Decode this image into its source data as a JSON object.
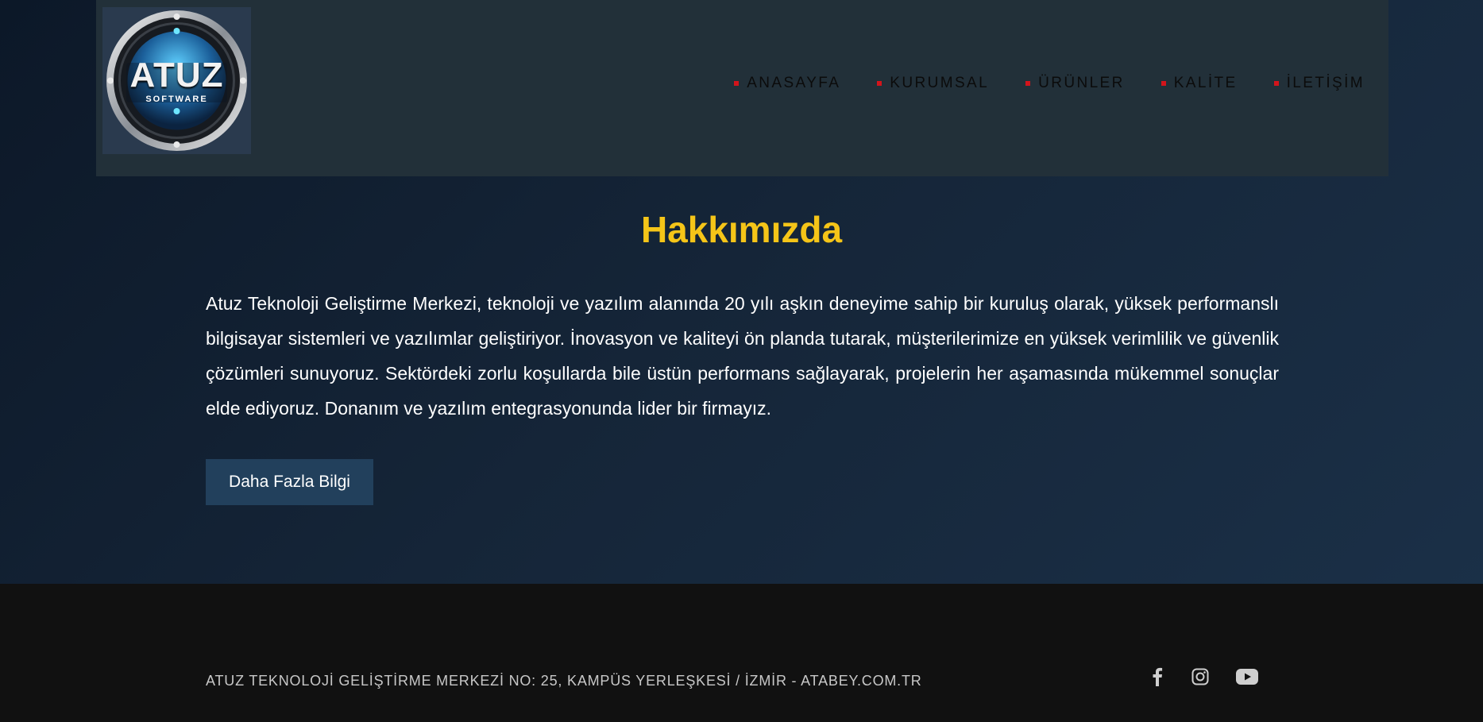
{
  "header": {
    "logo": {
      "text": "ATUZ",
      "subtext": "SOFTWARE"
    },
    "nav": [
      {
        "label": "ANASAYFA"
      },
      {
        "label": "KURUMSAL"
      },
      {
        "label": "ÜRÜNLER"
      },
      {
        "label": "KALİTE"
      },
      {
        "label": "İLETİŞİM"
      }
    ]
  },
  "main": {
    "title": "Hakkımızda",
    "paragraph": "Atuz Teknoloji Geliştirme Merkezi, teknoloji ve yazılım alanında 20 yılı aşkın deneyime sahip bir kuruluş olarak, yüksek performanslı bilgisayar sistemleri ve yazılımlar geliştiriyor. İnovasyon ve kaliteyi ön planda tutarak, müşterilerimize en yüksek verimlilik ve güvenlik çözümleri sunuyoruz. Sektördeki zorlu koşullarda bile üstün performans sağlayarak, projelerin her aşamasında mükemmel sonuçlar elde ediyoruz. Donanım ve yazılım entegrasyonunda lider bir firmayız.",
    "button_label": "Daha Fazla Bilgi"
  },
  "footer": {
    "address": "ATUZ TEKNOLOJİ GELİŞTİRME MERKEZİ NO: 25, KAMPÜS YERLEŞKESİ / İZMİR - ATABEY.COM.TR",
    "socials": [
      "facebook-icon",
      "instagram-icon",
      "youtube-icon"
    ]
  },
  "colors": {
    "accent_title": "#f5c518",
    "nav_bullet": "#d3141b",
    "button_bg": "#22405c",
    "footer_bg": "#111111"
  }
}
